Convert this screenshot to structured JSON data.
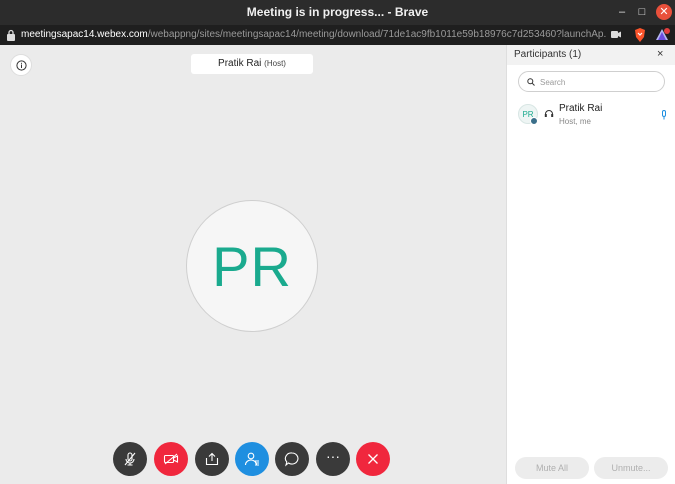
{
  "window": {
    "title": "Meeting is in progress... - Brave"
  },
  "urlbar": {
    "domain": "meetingsapac14.webex.com",
    "path": "/webappng/sites/meetingsapac14/meeting/download/71de1ac9fb1011e59b18976c7d253460?launchAp..."
  },
  "stage": {
    "speaker_name": "Pratik Rai",
    "speaker_role": "(Host)",
    "avatar_initials": "PR",
    "more_label": "···"
  },
  "panel": {
    "title": "Participants (1)",
    "close": "×",
    "search_placeholder": "Search",
    "participants": [
      {
        "initials": "PR",
        "name": "Pratik Rai",
        "role": "Host, me"
      }
    ],
    "mute_all": "Mute All",
    "unmute": "Unmute..."
  },
  "icons": [
    "lock-icon",
    "camera-icon",
    "brave-shield-icon",
    "bat-rewards-icon",
    "info-icon",
    "microphone-muted-icon",
    "video-off-icon",
    "share-icon",
    "participants-icon",
    "chat-icon",
    "more-icon",
    "end-call-icon",
    "search-icon",
    "headset-icon",
    "microphone-icon"
  ],
  "colors": {
    "accent": "#1aaa8e",
    "end_red": "#f0273d",
    "participants_blue": "#1f8fe0"
  }
}
